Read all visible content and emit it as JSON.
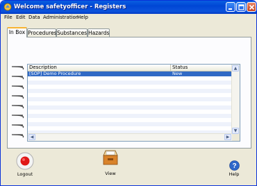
{
  "window": {
    "title": "Welcome safetyofficer - Registers"
  },
  "menu": [
    "File",
    "Edit",
    "Data",
    "Administration",
    "Help"
  ],
  "tabs": [
    "In Box",
    "Procedures",
    "Substances",
    "Hazards"
  ],
  "table": {
    "columns": [
      "Description",
      "Status"
    ],
    "rows": [
      {
        "description": "[SOP] Demo Procedure",
        "status": "New"
      }
    ]
  },
  "actions": {
    "logout": "Logout",
    "view": "View",
    "help": "Help"
  },
  "icons": {
    "app": "app-icon",
    "logout": "logout-icon",
    "view": "view-tray-icon",
    "help": "help-icon"
  }
}
